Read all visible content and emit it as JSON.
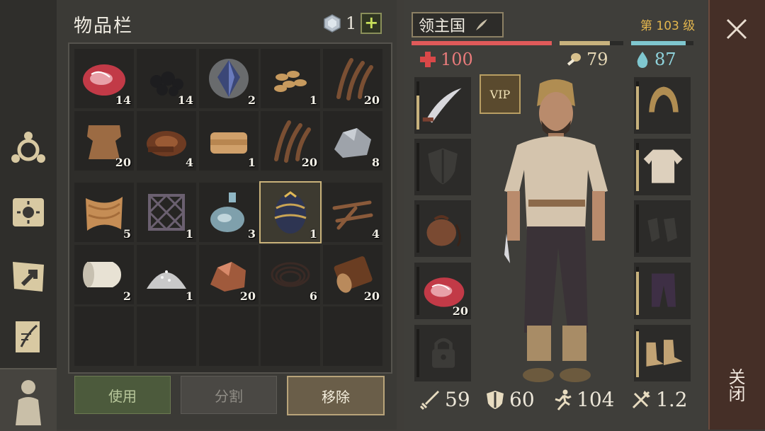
{
  "inventory": {
    "title": "物品栏",
    "currency_count": "1",
    "add_label": "+",
    "rows": [
      [
        {
          "name": "raw-meat",
          "qty": "14"
        },
        {
          "name": "coal",
          "qty": "14"
        },
        {
          "name": "crystal",
          "qty": "2"
        },
        {
          "name": "seeds",
          "qty": "1"
        },
        {
          "name": "plant-fiber",
          "qty": "20"
        }
      ],
      [
        {
          "name": "hide",
          "qty": "20"
        },
        {
          "name": "leather-roll",
          "qty": "4"
        },
        {
          "name": "cloth-bundle",
          "qty": "1"
        },
        {
          "name": "plant-fiber",
          "qty": "20"
        },
        {
          "name": "iron-ore",
          "qty": "8"
        }
      ],
      [
        {
          "name": "fabric-scrap",
          "qty": "5"
        },
        {
          "name": "lattice-frame",
          "qty": "1"
        },
        {
          "name": "glass-flask",
          "qty": "3"
        },
        {
          "name": "dragon-egg",
          "qty": "1"
        },
        {
          "name": "nails",
          "qty": "4"
        }
      ],
      [
        {
          "name": "paper-roll",
          "qty": "2"
        },
        {
          "name": "salt-pile",
          "qty": "1"
        },
        {
          "name": "copper-ore",
          "qty": "20"
        },
        {
          "name": "wire-coil",
          "qty": "6"
        },
        {
          "name": "log",
          "qty": "20"
        }
      ],
      [
        {
          "name": "empty",
          "qty": ""
        },
        {
          "name": "empty",
          "qty": ""
        },
        {
          "name": "empty",
          "qty": ""
        },
        {
          "name": "empty",
          "qty": ""
        },
        {
          "name": "empty",
          "qty": ""
        }
      ]
    ],
    "buttons": {
      "use": "使用",
      "split": "分割",
      "remove": "移除"
    }
  },
  "character": {
    "name": "领主国",
    "level": "第 103 级",
    "health": "100",
    "hunger": "79",
    "thirst": "87",
    "health_fill": 1.0,
    "hunger_fill": 0.79,
    "thirst_fill": 0.87,
    "vip_label": "VIP",
    "left_slots": [
      {
        "name": "scimitar",
        "qty": "",
        "durability": 0.7
      },
      {
        "name": "shield-empty",
        "qty": "",
        "durability": 0
      },
      {
        "name": "pouch",
        "qty": "",
        "durability": 0
      },
      {
        "name": "raw-meat",
        "qty": "20",
        "durability": 0
      },
      {
        "name": "locked",
        "qty": "",
        "durability": 0
      }
    ],
    "right_slots": [
      {
        "name": "hood",
        "durability": 0.9
      },
      {
        "name": "shirt",
        "durability": 0.85
      },
      {
        "name": "gloves-empty",
        "durability": 0
      },
      {
        "name": "trousers",
        "durability": 0.9
      },
      {
        "name": "boots",
        "durability": 0.95
      }
    ],
    "stats": {
      "attack": "59",
      "defense": "60",
      "speed": "104",
      "weight": "1.2"
    }
  },
  "close": {
    "label": "关闭"
  },
  "colors": {
    "health": "#e05a5a",
    "hunger": "#c8b27d",
    "thirst": "#7fc7cf",
    "level": "#e3b64e"
  }
}
